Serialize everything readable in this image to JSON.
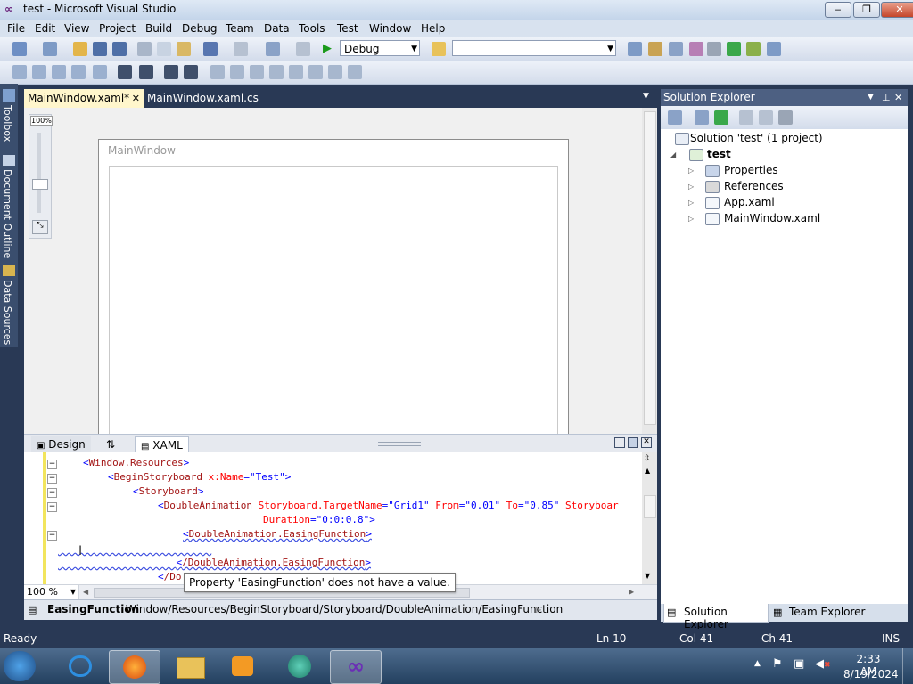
{
  "window": {
    "title": "test - Microsoft Visual Studio",
    "controls": {
      "minimize": "‒",
      "maximize": "❐",
      "close": "✕"
    }
  },
  "menu": [
    "File",
    "Edit",
    "View",
    "Project",
    "Build",
    "Debug",
    "Team",
    "Data",
    "Tools",
    "Test",
    "Window",
    "Help"
  ],
  "toolbar": {
    "config_combo": "Debug",
    "search_combo": ""
  },
  "left_strip": {
    "tabs": [
      "Toolbox",
      "Document Outline",
      "Data Sources"
    ]
  },
  "doc_tabs": [
    {
      "label": "MainWindow.xaml*",
      "active": true
    },
    {
      "label": "MainWindow.xaml.cs",
      "active": false
    }
  ],
  "doc_tab_close": "✕",
  "designer": {
    "zoom": "100%",
    "window_title": "MainWindow"
  },
  "split": {
    "design": "Design",
    "swap": "⇅",
    "xaml": "XAML"
  },
  "xaml_code": [
    [
      "Window.Resources"
    ],
    [
      "BeginStoryboard",
      "x:Name",
      "Test"
    ],
    [
      "Storyboard"
    ],
    [
      "DoubleAnimation",
      "Storyboard.TargetName",
      "Grid1",
      "From",
      "0.01",
      "To",
      "0.85",
      "Storyboar"
    ],
    [
      "Duration",
      "0:0:0.8"
    ],
    [
      "DoubleAnimation.EasingFunction"
    ],
    [],
    [
      "/DoubleAnimation.EasingFunction"
    ],
    [
      "/Do"
    ]
  ],
  "code_lines": {
    "l1_tag": "Window.Resources",
    "l2_tag": "BeginStoryboard",
    "l2_attr": "x:Name",
    "l2_val": "\"Test\"",
    "l3_tag": "Storyboard",
    "l4_tag": "DoubleAnimation",
    "l4_attr1": "Storyboard.TargetName",
    "l4_val1": "\"Grid1\"",
    "l4_attr2": "From",
    "l4_val2": "\"0.01\"",
    "l4_attr3": "To",
    "l4_val3": "\"0.85\"",
    "l4_attr4": "Storyboar",
    "l5_attr": "Duration",
    "l5_val": "\"0:0:0.8\"",
    "l6_tag": "DoubleAnimation.EasingFunction",
    "l8_tag": "/DoubleAnimation.EasingFunction",
    "l9_tag": "/Do"
  },
  "editor_zoom": "100 %",
  "tooltip": "Property 'EasingFunction' does not have a value.",
  "breadcrumb": {
    "current": "EasingFunction",
    "path": "Window/Resources/BeginStoryboard/Storyboard/DoubleAnimation/EasingFunction"
  },
  "solution_explorer": {
    "title": "Solution Explorer",
    "solution": "Solution 'test' (1 project)",
    "project": "test",
    "items": [
      "Properties",
      "References",
      "App.xaml",
      "MainWindow.xaml"
    ],
    "tabs": [
      "Solution Explorer",
      "Team Explorer"
    ]
  },
  "status": {
    "ready": "Ready",
    "ln": "Ln 10",
    "col": "Col 41",
    "ch": "Ch 41",
    "ins": "INS"
  },
  "clock": {
    "time": "2:33 AM",
    "date": "8/19/2024"
  },
  "colors": {
    "accent": "#293955",
    "active_tab": "#fff6cc",
    "tag": "#a31515",
    "attr": "#ff0000",
    "value": "#0000ff"
  }
}
